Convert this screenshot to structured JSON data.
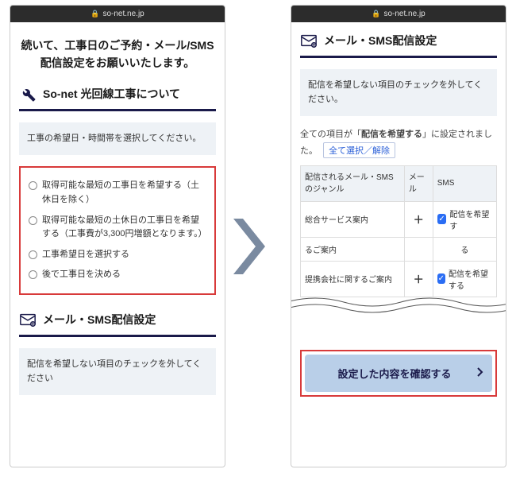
{
  "url": "so-net.ne.jp",
  "left": {
    "heading": "続いて、工事日のご予約・メール/SMS配信設定をお願いいたします。",
    "section1_title": "So-net 光回線工事について",
    "notice1": "工事の希望日・時間帯を選択してください。",
    "options": [
      "取得可能な最短の工事日を希望する（土休日を除く）",
      "取得可能な最短の土休日の工事日を希望する（工事費が3,300円増額となります。）",
      "工事希望日を選択する",
      "後で工事日を決める"
    ],
    "section2_title": "メール・SMS配信設定",
    "notice2": "配信を希望しない項目のチェックを外してください"
  },
  "right": {
    "section_title": "メール・SMS配信設定",
    "notice": "配信を希望しない項目のチェックを外してください。",
    "status_pre": "全ての項目が「",
    "status_em": "配信を希望する",
    "status_post": "」に設定されました。",
    "toggle_all": "全て選択／解除",
    "th_genre": "配信されるメール・SMSのジャンル",
    "th_mail": "メール",
    "th_sms": "SMS",
    "rows": [
      {
        "label": "総合サービス案内",
        "check": "配信を希望す"
      },
      {
        "label_top": "るご案内",
        "label": "るご案内",
        "check": "る"
      },
      {
        "label": "提携会社に関するご案内",
        "check": "配信を希望する"
      }
    ],
    "confirm": "設定した内容を確認する"
  }
}
